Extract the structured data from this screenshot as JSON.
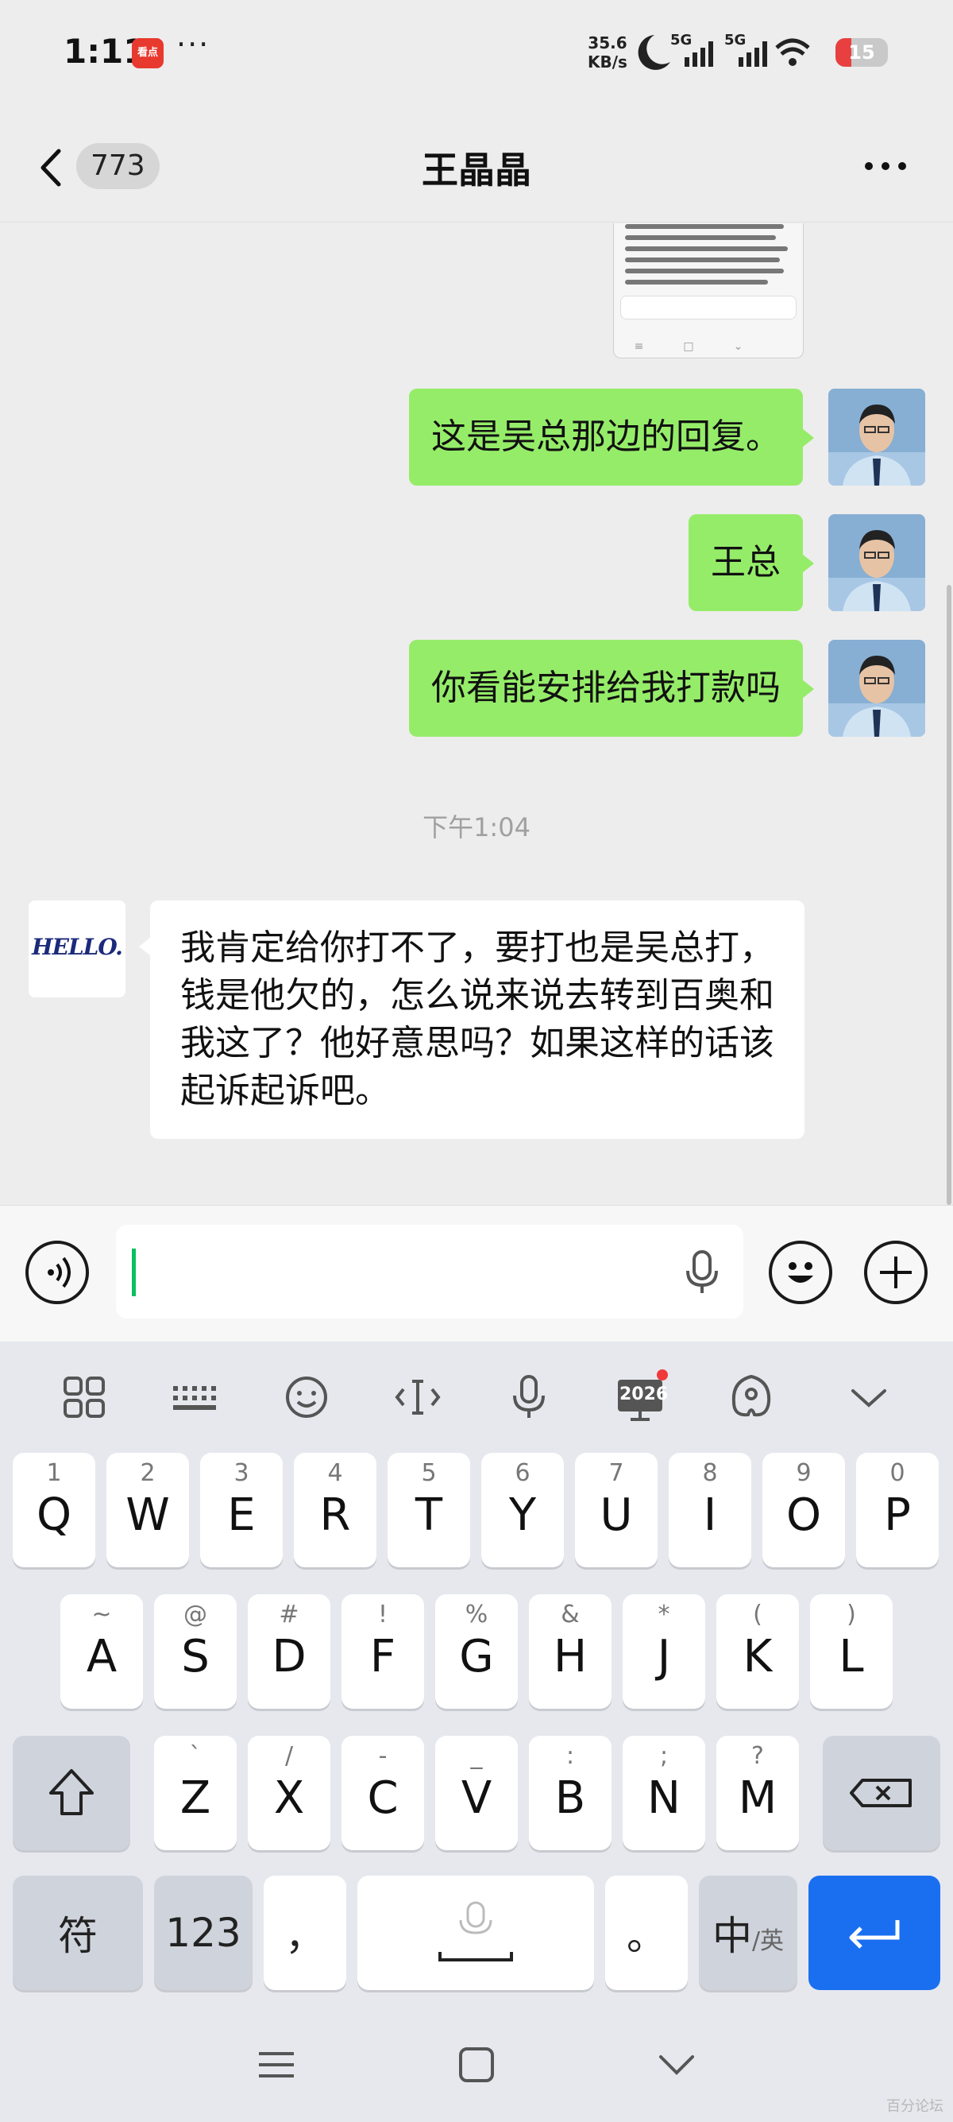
{
  "status_bar": {
    "time": "1:11",
    "app_icon_label": "看点",
    "overflow": "···",
    "net_speed_value": "35.6",
    "net_speed_unit": "KB/s",
    "signal1": "5G",
    "signal2": "5G",
    "battery": "15"
  },
  "header": {
    "unread_count": "773",
    "title": "王晶晶",
    "more_icon": "more-dots-icon"
  },
  "messages": {
    "image_preview_text": "的回复，这是吴总那边的回复，下笔再再给他安排一笔款，这样就比较好了，我现在就这个情况，上次我跟他说过，按道理应该知道这个情况的。",
    "me_1": "这是吴总那边的回复。",
    "me_2": "王总",
    "me_3": "你看能安排给我打款吗",
    "timestamp": "下午1:04",
    "them_1": "我肯定给你打不了，要打也是吴总打，钱是他欠的，怎么说来说去转到百奥和我这了？他好意思吗？如果这样的话该起诉起诉吧。",
    "them_avatar_text": "HELLO."
  },
  "input_bar": {
    "voice_icon": "voice-mode-icon",
    "emoji_icon": "emoji-icon",
    "plus_icon": "plus-icon",
    "value": ""
  },
  "keyboard": {
    "toolbar_badge": "2026",
    "row1": [
      {
        "hint": "1",
        "key": "Q"
      },
      {
        "hint": "2",
        "key": "W"
      },
      {
        "hint": "3",
        "key": "E"
      },
      {
        "hint": "4",
        "key": "R"
      },
      {
        "hint": "5",
        "key": "T"
      },
      {
        "hint": "6",
        "key": "Y"
      },
      {
        "hint": "7",
        "key": "U"
      },
      {
        "hint": "8",
        "key": "I"
      },
      {
        "hint": "9",
        "key": "O"
      },
      {
        "hint": "0",
        "key": "P"
      }
    ],
    "row2": [
      {
        "hint": "~",
        "key": "A"
      },
      {
        "hint": "@",
        "key": "S"
      },
      {
        "hint": "#",
        "key": "D"
      },
      {
        "hint": "!",
        "key": "F"
      },
      {
        "hint": "%",
        "key": "G"
      },
      {
        "hint": "&",
        "key": "H"
      },
      {
        "hint": "*",
        "key": "J"
      },
      {
        "hint": "(",
        "key": "K"
      },
      {
        "hint": ")",
        "key": "L"
      }
    ],
    "row3": [
      {
        "hint": "`",
        "key": "Z"
      },
      {
        "hint": "/",
        "key": "X"
      },
      {
        "hint": "-",
        "key": "C"
      },
      {
        "hint": "_",
        "key": "V"
      },
      {
        "hint": ":",
        "key": "B"
      },
      {
        "hint": ";",
        "key": "N"
      },
      {
        "hint": "?",
        "key": "M"
      }
    ],
    "symbols_key": "符",
    "numbers_key": "123",
    "comma_key": "，",
    "period_key": "。",
    "lang_key_main": "中",
    "lang_key_sub": "/英"
  },
  "watermark": "百分论坛"
}
